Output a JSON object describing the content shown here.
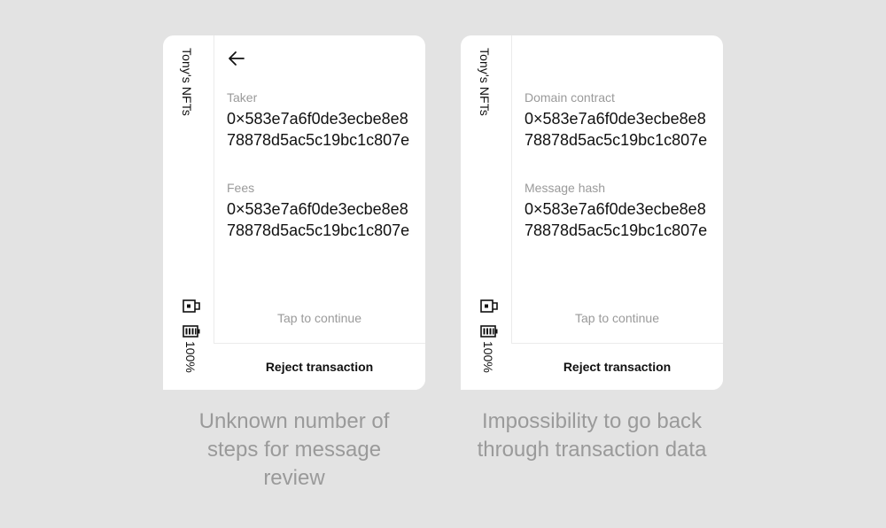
{
  "colors": {
    "background": "#e3e3e3",
    "device": "#ffffff",
    "text": "#111111",
    "muted": "#9a9a9a",
    "divider": "#ebebeb"
  },
  "screens": [
    {
      "app_name": "Tony's NFTs",
      "battery": "100%",
      "has_back": true,
      "fields": [
        {
          "label": "Taker",
          "value": "0×583e7a6f0de3ecbe8e878878d5ac5c19bc1c807e"
        },
        {
          "label": "Fees",
          "value": "0×583e7a6f0de3ecbe8e878878d5ac5c19bc1c807e"
        }
      ],
      "tap_hint": "Tap to continue",
      "reject_label": "Reject transaction",
      "caption": "Unknown number of steps for message review"
    },
    {
      "app_name": "Tony's NFTs",
      "battery": "100%",
      "has_back": false,
      "fields": [
        {
          "label": "Domain contract",
          "value": "0×583e7a6f0de3ecbe8e878878d5ac5c19bc1c807e"
        },
        {
          "label": "Message hash",
          "value": "0×583e7a6f0de3ecbe8e878878d5ac5c19bc1c807e"
        }
      ],
      "tap_hint": "Tap to continue",
      "reject_label": "Reject transaction",
      "caption": "Impossibility to go back through transaction data"
    }
  ],
  "icons": {
    "back": "arrow-left-icon",
    "usb": "usb-icon",
    "battery": "battery-icon"
  }
}
